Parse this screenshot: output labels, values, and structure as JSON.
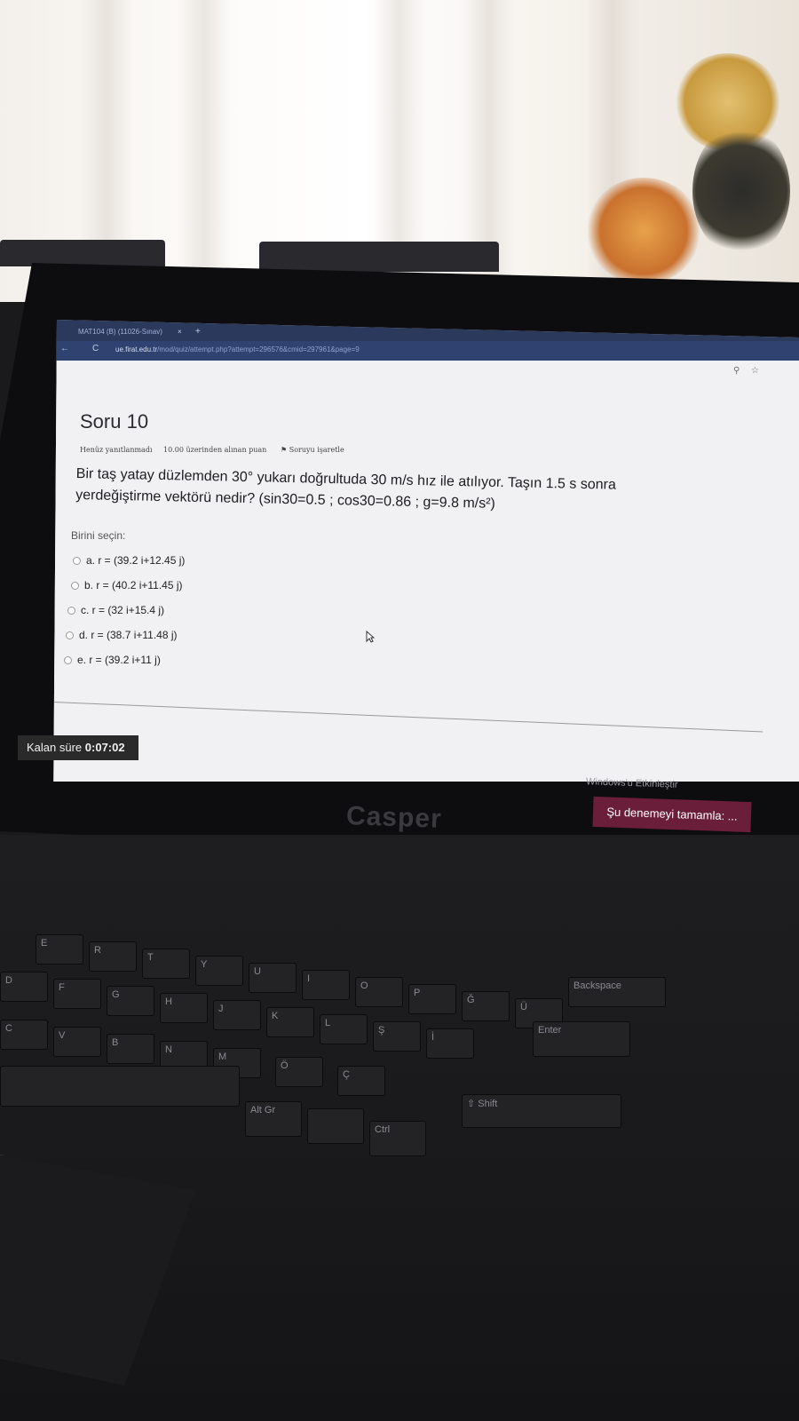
{
  "browser": {
    "tab_title": "MAT104 (B) (11026-Sınav)",
    "tab_close": "×",
    "new_tab": "+",
    "back": "←",
    "reload": "C",
    "url_domain": "ue.firat.edu.tr",
    "url_path": "/mod/quiz/attempt.php?attempt=296576&cmid=297961&page=9",
    "search_icon": "⚲",
    "star_icon": "☆"
  },
  "question": {
    "title": "Soru 10",
    "status": "Henüz yanıtlanmadı",
    "points": "10.00 üzerinden alınan puan",
    "flag_label": "Soruyu işaretle",
    "text_line1": "Bir taş yatay düzlemden 30° yukarı doğrultuda 30 m/s hız ile atılıyor. Taşın 1.5 s sonra",
    "text_line2": "yerdeğiştirme vektörü nedir? (sin30=0.5 ; cos30=0.86 ;  g=9.8 m/s²)",
    "choose_label": "Birini seçin:",
    "options": [
      "a. r = (39.2 i+12.45 j)",
      "b. r = (40.2 i+11.45 j)",
      "c. r = (32 i+15.4 j)",
      "d. r = (38.7 i+11.48 j)",
      "e. r = (39.2 i+11 j)"
    ]
  },
  "timer": {
    "label": "Kalan süre",
    "value": "0:07:02"
  },
  "windows_activation": "Windows'u Etkinleştir",
  "finish_button": "Şu denemeyi tamamla: ...",
  "laptop_brand": "Casper",
  "keyboard": {
    "row1": [
      "E",
      "R",
      "T",
      "Y",
      "U",
      "I",
      "O",
      "P",
      "Ğ",
      "Ü"
    ],
    "row2": [
      "D",
      "F",
      "G",
      "H",
      "J",
      "K",
      "L",
      "Ş",
      "İ"
    ],
    "row3": [
      "C",
      "V",
      "B",
      "N",
      "M",
      "Ö",
      "Ç"
    ],
    "alt_gr": "Alt Gr",
    "ctrl": "Ctrl",
    "shift": "⇧ Shift",
    "enter": "Enter",
    "backspace": "Backspace"
  },
  "colors": {
    "finish_button": "#6b1e3a",
    "timer_bg": "#2a2a2a",
    "browser_bar": "#2f4270"
  }
}
